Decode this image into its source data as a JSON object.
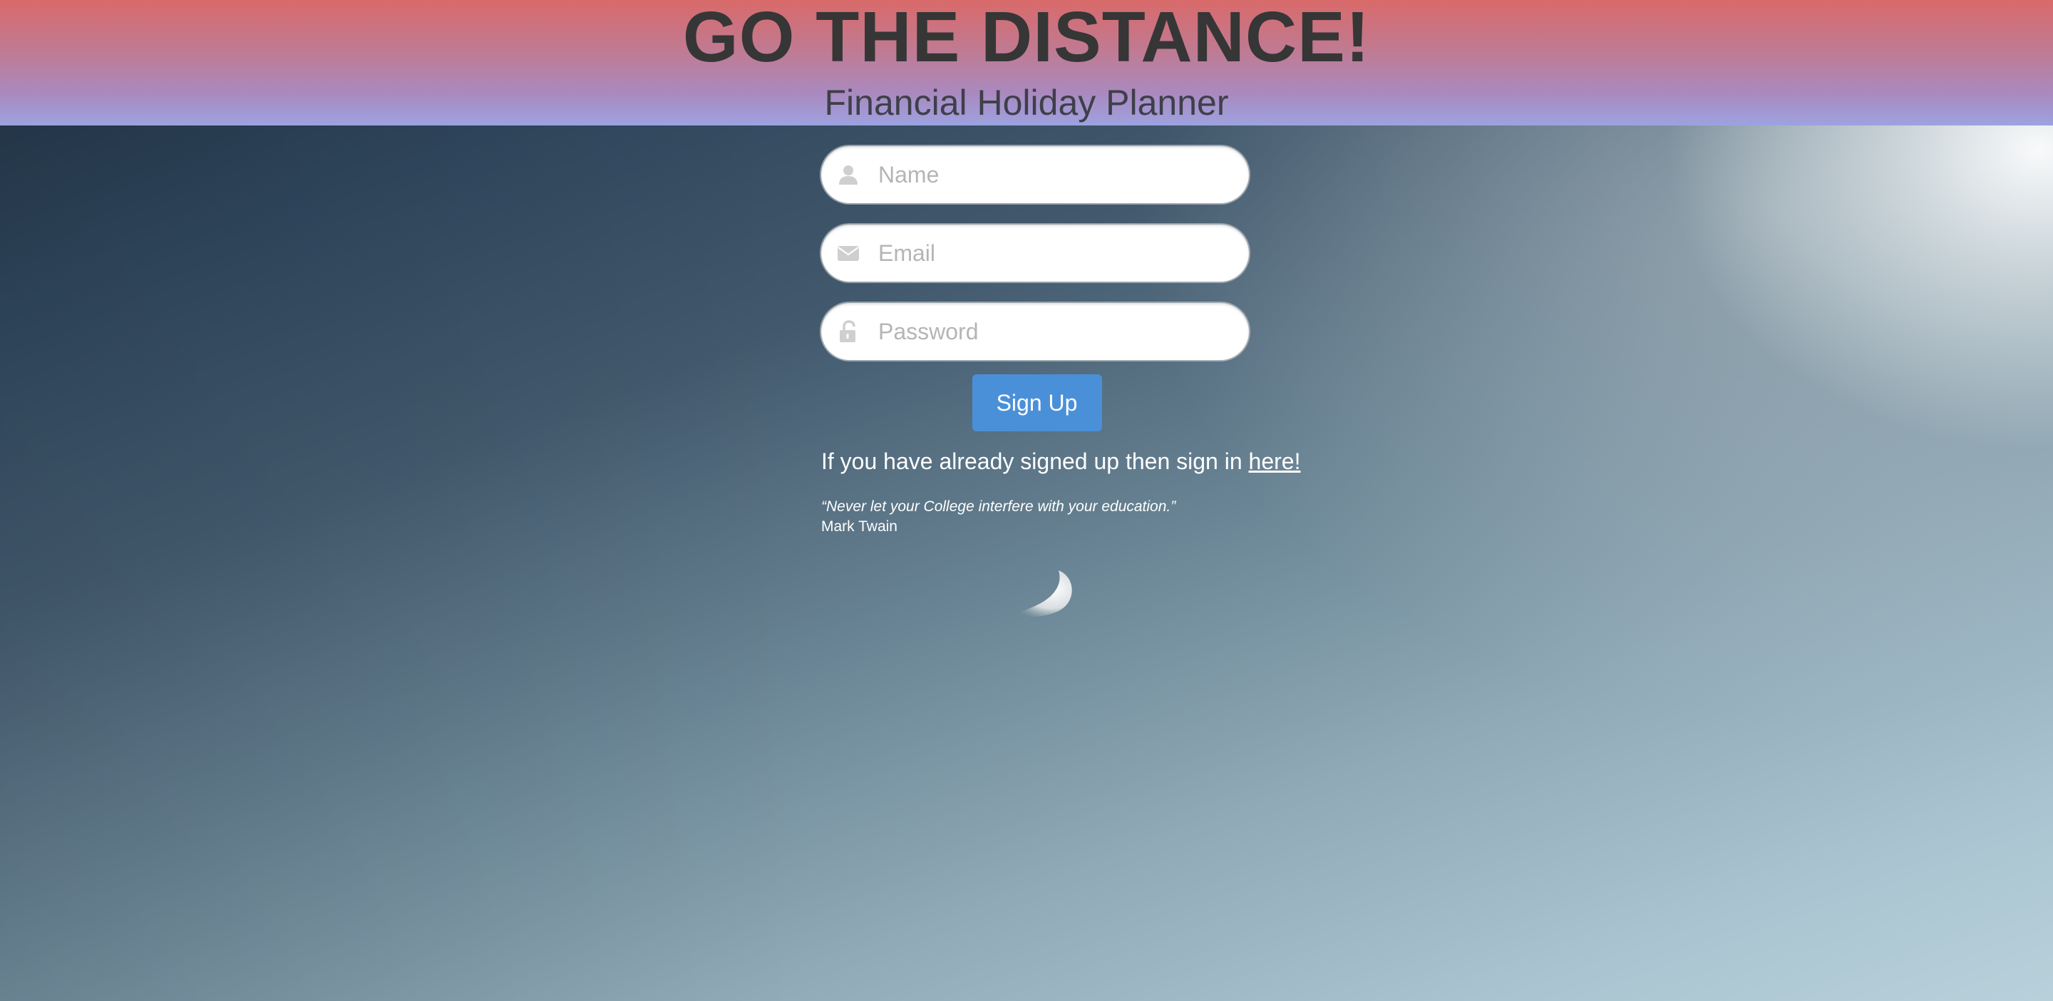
{
  "header": {
    "title": "GO THE DISTANCE!",
    "subtitle": "Financial Holiday Planner"
  },
  "form": {
    "name": {
      "placeholder": "Name",
      "value": "",
      "icon": "user-icon"
    },
    "email": {
      "placeholder": "Email",
      "value": "",
      "icon": "envelope-icon"
    },
    "password": {
      "placeholder": "Password",
      "value": "",
      "icon": "unlock-icon"
    },
    "submit_label": "Sign Up"
  },
  "signin": {
    "text": "If you have already signed up then sign in",
    "link_label": "here!"
  },
  "quote": {
    "text": "“Never let your College interfere with your education.”",
    "author": "Mark Twain"
  },
  "colors": {
    "header_top": "#d96a6a",
    "header_bottom": "#9da2e0",
    "title_text": "#363636",
    "button": "#4a90d9"
  }
}
